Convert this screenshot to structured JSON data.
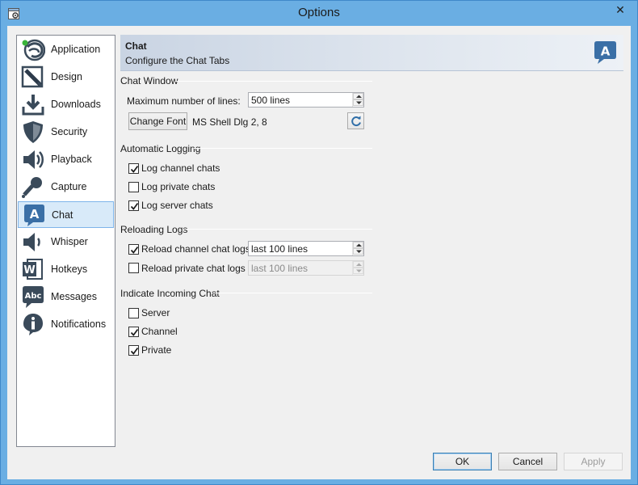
{
  "window": {
    "title": "Options",
    "close_glyph": "✕"
  },
  "sidebar": {
    "items": [
      {
        "label": "Application",
        "icon": "application-icon"
      },
      {
        "label": "Design",
        "icon": "design-icon"
      },
      {
        "label": "Downloads",
        "icon": "downloads-icon"
      },
      {
        "label": "Security",
        "icon": "security-icon"
      },
      {
        "label": "Playback",
        "icon": "playback-icon"
      },
      {
        "label": "Capture",
        "icon": "capture-icon"
      },
      {
        "label": "Chat",
        "icon": "chat-icon",
        "selected": true
      },
      {
        "label": "Whisper",
        "icon": "whisper-icon"
      },
      {
        "label": "Hotkeys",
        "icon": "hotkeys-icon"
      },
      {
        "label": "Messages",
        "icon": "messages-icon"
      },
      {
        "label": "Notifications",
        "icon": "notifications-icon"
      }
    ]
  },
  "header": {
    "title": "Chat",
    "subtitle": "Configure the Chat Tabs"
  },
  "chat_window": {
    "title": "Chat Window",
    "max_lines_label": "Maximum number of lines:",
    "max_lines_value": "500 lines",
    "change_font_label": "Change Font",
    "font_value": "MS Shell Dlg 2, 8"
  },
  "logging": {
    "title": "Automatic Logging",
    "channel_label": "Log channel chats",
    "channel_checked": true,
    "private_label": "Log private chats",
    "private_checked": false,
    "server_label": "Log server chats",
    "server_checked": true
  },
  "reloading": {
    "title": "Reloading Logs",
    "channel_label": "Reload channel chat logs",
    "channel_checked": true,
    "channel_value": "last 100 lines",
    "private_label": "Reload private chat logs",
    "private_checked": false,
    "private_value": "last 100 lines"
  },
  "incoming": {
    "title": "Indicate Incoming Chat",
    "server_label": "Server",
    "server_checked": false,
    "channel_label": "Channel",
    "channel_checked": true,
    "private_label": "Private",
    "private_checked": true
  },
  "footer": {
    "ok_label": "OK",
    "cancel_label": "Cancel",
    "apply_label": "Apply"
  },
  "colors": {
    "titlebar": "#6aaee3",
    "selection": "#d8eaf9",
    "accent_icon": "#3a6fa6"
  }
}
